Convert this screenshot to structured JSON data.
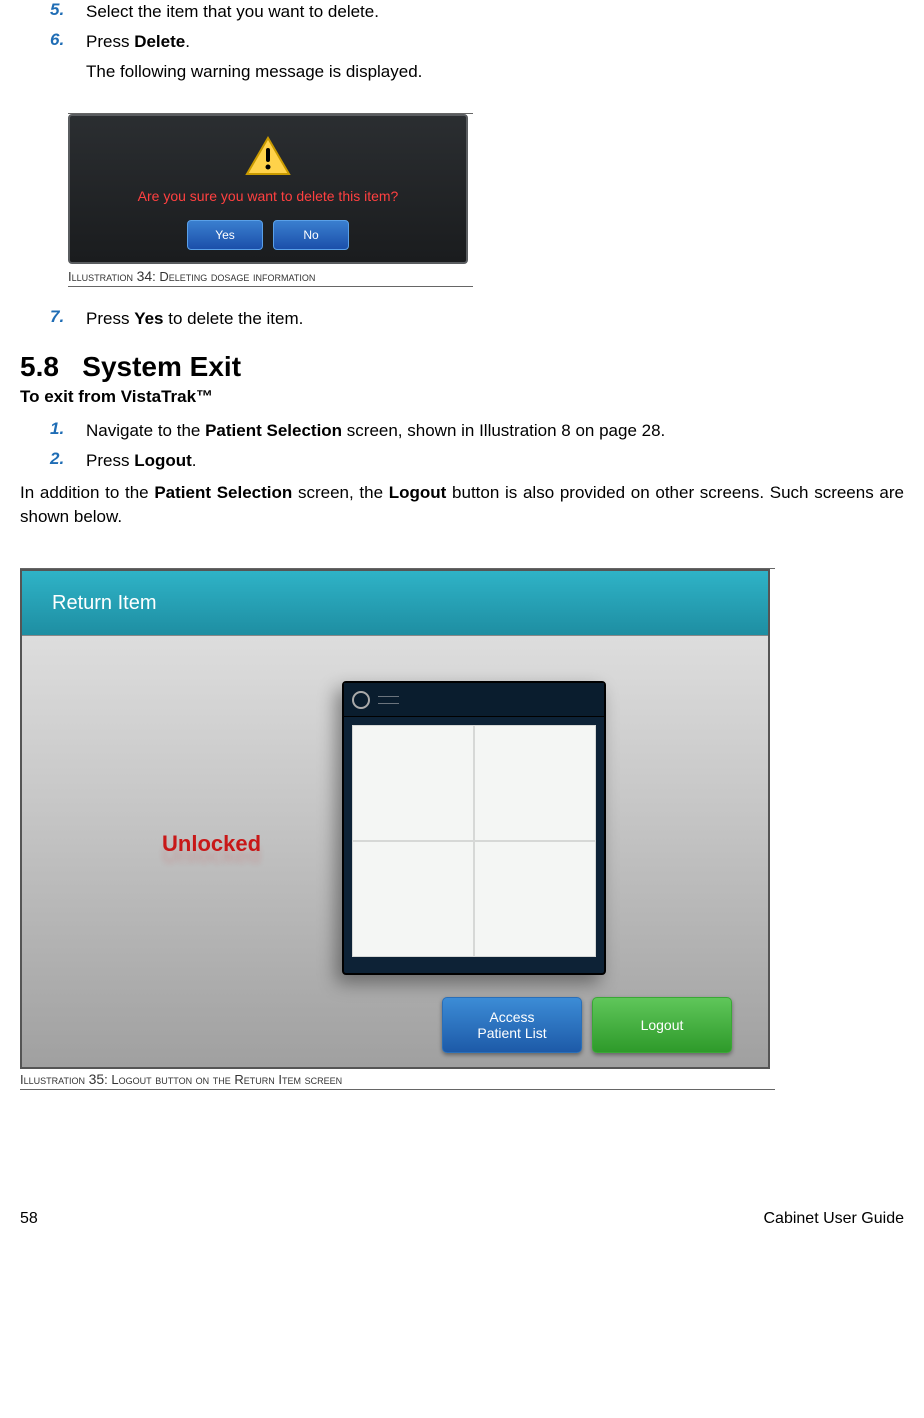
{
  "steps_a": [
    {
      "num": "5.",
      "text_parts": [
        "Select the item that you want to delete."
      ]
    },
    {
      "num": "6.",
      "text_parts": [
        "Press ",
        "Delete",
        "."
      ]
    }
  ],
  "step6_followup": "The following warning message is displayed.",
  "dialog": {
    "message": "Are you sure you want to delete this item?",
    "yes": "Yes",
    "no": "No"
  },
  "illus34": {
    "prefix": "Illustration ",
    "num": "34",
    "sep": ": ",
    "title": "Deleting dosage information"
  },
  "step7": {
    "num": "7.",
    "text_parts": [
      "Press ",
      "Yes",
      " to delete the item."
    ]
  },
  "section": {
    "num": "5.8",
    "title": "System Exit"
  },
  "subhead": "To exit from VistaTrak™",
  "steps_b": [
    {
      "num": "1.",
      "text_parts": [
        "Navigate to the ",
        "Patient Selection",
        " screen, shown  in Illustration 8 on page 28."
      ]
    },
    {
      "num": "2.",
      "text_parts": [
        "Press ",
        "Logout",
        "."
      ]
    }
  ],
  "addition_parts": [
    "In addition to the ",
    "Patient Selection",
    " screen, the ",
    "Logout",
    " button is also provided on other screens. Such screens are shown below."
  ],
  "return_item": {
    "header": "Return Item",
    "unlocked": "Unlocked",
    "access": "Access\nPatient List",
    "logout": "Logout"
  },
  "illus35": {
    "prefix": "Illustration ",
    "num": "35",
    "sep": ": ",
    "title": "Logout button on the Return Item screen"
  },
  "footer": {
    "page": "58",
    "doc": "Cabinet User Guide"
  }
}
